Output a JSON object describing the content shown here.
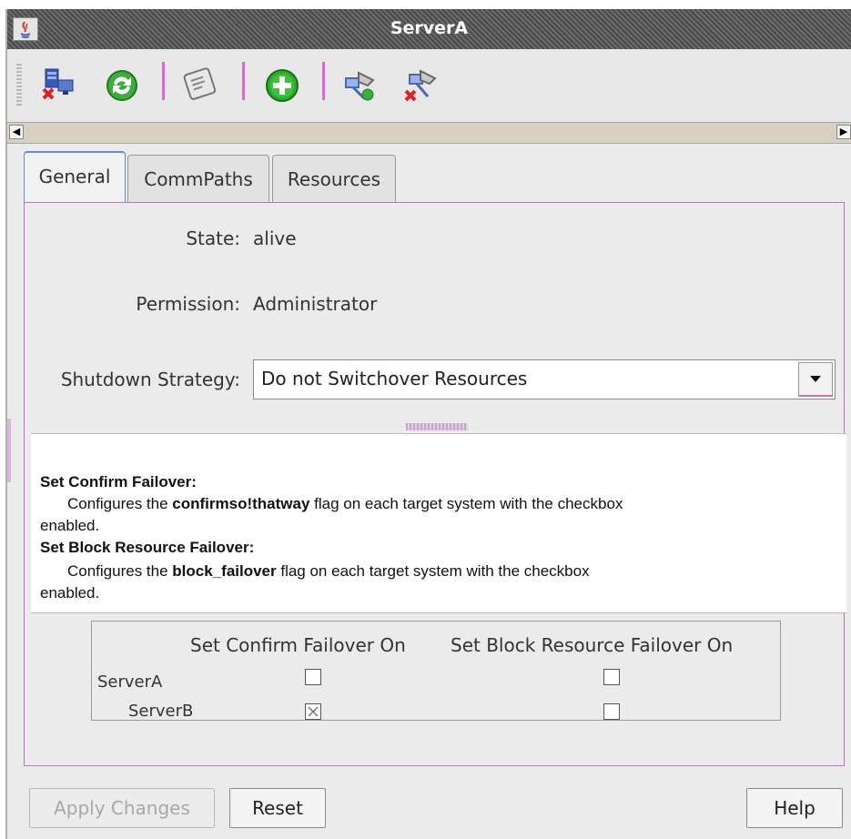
{
  "window": {
    "title": "ServerA"
  },
  "toolbar": {
    "buttons": [
      {
        "icon": "disconnect-server-icon"
      },
      {
        "icon": "refresh-icon"
      },
      {
        "icon": "script-icon"
      },
      {
        "icon": "add-icon"
      },
      {
        "icon": "connect-network-icon"
      },
      {
        "icon": "disconnect-network-icon"
      }
    ]
  },
  "tabs": [
    {
      "label": "General",
      "active": true
    },
    {
      "label": "CommPaths",
      "active": false
    },
    {
      "label": "Resources",
      "active": false
    }
  ],
  "general": {
    "state_label": "State:",
    "state_value": "alive",
    "permission_label": "Permission:",
    "permission_value": "Administrator",
    "shutdown_label": "Shutdown Strategy:",
    "shutdown_value": "Do not Switchover Resources"
  },
  "info": {
    "confirm_heading": "Set Confirm Failover:",
    "confirm_pre": "Configures the ",
    "confirm_flag": "confirmso!thatway",
    "confirm_post": " flag on each target system with the checkbox",
    "confirm_tail": "enabled.",
    "block_heading": "Set Block Resource Failover:",
    "block_pre": "Configures the ",
    "block_flag": "block_failover",
    "block_post": " flag on each target system with the checkbox",
    "block_tail": "enabled."
  },
  "failover_table": {
    "col_confirm": "Set Confirm Failover On",
    "col_block": "Set Block Resource Failover On",
    "rows": [
      {
        "server": "ServerA",
        "confirm": false,
        "block": false
      },
      {
        "server": "ServerB",
        "confirm": true,
        "block": false
      }
    ]
  },
  "footer": {
    "apply_label": "Apply Changes",
    "reset_label": "Reset",
    "help_label": "Help"
  },
  "colors": {
    "accent": "#c070c0",
    "title_bar": "#555555",
    "active_tab_border": "#6a8ad0"
  }
}
